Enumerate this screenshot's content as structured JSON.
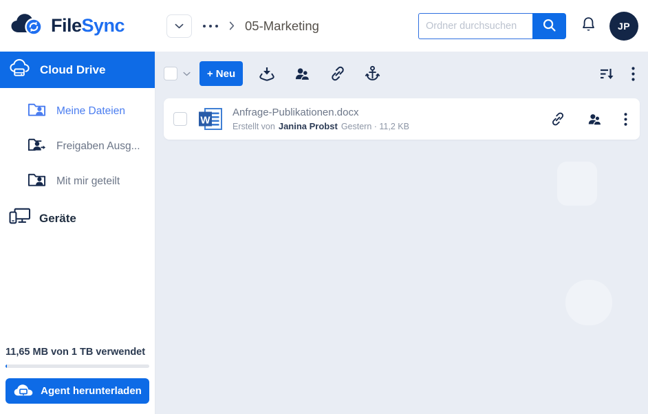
{
  "brand": {
    "name_part1": "File",
    "name_part2": "Sync"
  },
  "topbar": {
    "breadcrumb": {
      "current_folder": "05-Marketing"
    },
    "search": {
      "placeholder": "Ordner durchsuchen"
    },
    "avatar_initials": "JP"
  },
  "sidebar": {
    "drive_label": "Cloud Drive",
    "items": [
      {
        "label": "Meine Dateien",
        "active": true
      },
      {
        "label": "Freigaben Ausg...",
        "active": false
      },
      {
        "label": "Mit mir geteilt",
        "active": false
      }
    ],
    "devices_label": "Geräte",
    "storage_text": "11,65 MB von 1 TB verwendet",
    "agent_button_label": "Agent herunterladen"
  },
  "toolbar": {
    "new_button_label": "+ Neu"
  },
  "file_list": [
    {
      "name": "Anfrage-Publikationen.docx",
      "file_type": "docx",
      "created_by_label": "Erstellt von",
      "creator_name": "Janina Probst",
      "date_size": "Gestern · 11,2 KB"
    }
  ],
  "icons": {
    "filesync-logo": "dark cloud with blue sync badge",
    "chevron-down-icon": "v",
    "breadcrumb-ellipsis-icon": "···",
    "chevron-right-icon": ">",
    "search-icon": "magnifier",
    "bell-icon": "notification bell outline",
    "cloud-drive-icon": "cloud with hard drive",
    "folder-user-icon": "folder with person",
    "folder-user-arrow-icon": "folder with person and outgoing arrow",
    "devices-icon": "monitor and phone",
    "agent-cloud-icon": "cloud with screen",
    "download-icon": "arrow into tray",
    "share-users-icon": "two people",
    "link-icon": "chain link",
    "anchor-icon": "anchor",
    "sort-desc-icon": "lines with down arrow",
    "kebab-icon": "vertical three dots",
    "word-file-icon": "Word document"
  },
  "colors": {
    "accent_blue": "#0e6be6",
    "navy": "#16294c",
    "main_background": "#e9edf4",
    "active_link_blue": "#4a7df0"
  }
}
